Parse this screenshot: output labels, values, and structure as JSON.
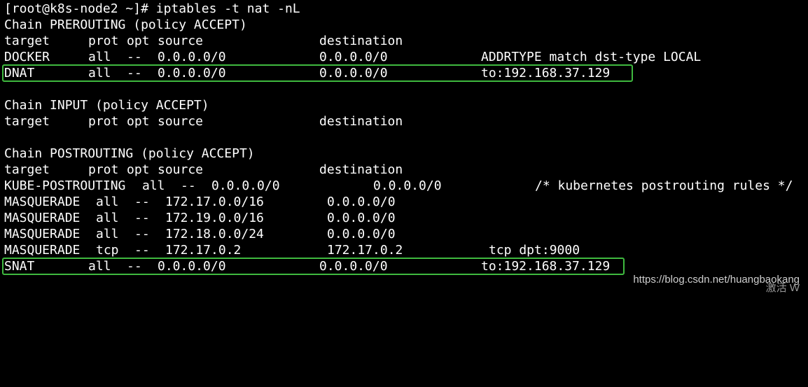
{
  "terminal": {
    "prompt_line": "[root@k8s-node2 ~]# iptables -t nat -nL",
    "prerouting": {
      "chain_header": "Chain PREROUTING (policy ACCEPT)",
      "columns": {
        "target": "target",
        "prot": "prot",
        "opt": "opt",
        "source": "source",
        "destination": "destination"
      },
      "rows": [
        {
          "target": "DOCKER",
          "prot": "all",
          "opt": "--",
          "source": "0.0.0.0/0",
          "destination": "0.0.0.0/0",
          "extra": "ADDRTYPE match dst-type LOCAL"
        },
        {
          "target": "DNAT",
          "prot": "all",
          "opt": "--",
          "source": "0.0.0.0/0",
          "destination": "0.0.0.0/0",
          "extra": "to:192.168.37.129"
        }
      ]
    },
    "input": {
      "chain_header": "Chain INPUT (policy ACCEPT)",
      "columns": {
        "target": "target",
        "prot": "prot",
        "opt": "opt",
        "source": "source",
        "destination": "destination"
      }
    },
    "postrouting": {
      "chain_header": "Chain POSTROUTING (policy ACCEPT)",
      "columns": {
        "target": "target",
        "prot": "prot",
        "opt": "opt",
        "source": "source",
        "destination": "destination"
      },
      "rows": [
        {
          "target": "KUBE-POSTROUTING",
          "prot": "all",
          "opt": "--",
          "source": "0.0.0.0/0",
          "destination": "0.0.0.0/0",
          "extra": "/* kubernetes postrouting rules */"
        },
        {
          "target": "MASQUERADE",
          "prot": "all",
          "opt": "--",
          "source": "172.17.0.0/16",
          "destination": "0.0.0.0/0",
          "extra": ""
        },
        {
          "target": "MASQUERADE",
          "prot": "all",
          "opt": "--",
          "source": "172.19.0.0/16",
          "destination": "0.0.0.0/0",
          "extra": ""
        },
        {
          "target": "MASQUERADE",
          "prot": "all",
          "opt": "--",
          "source": "172.18.0.0/24",
          "destination": "0.0.0.0/0",
          "extra": ""
        },
        {
          "target": "MASQUERADE",
          "prot": "tcp",
          "opt": "--",
          "source": "172.17.0.2",
          "destination": "172.17.0.2",
          "extra": "tcp dpt:9000"
        },
        {
          "target": "SNAT",
          "prot": "all",
          "opt": "--",
          "source": "0.0.0.0/0",
          "destination": "0.0.0.0/0",
          "extra": "to:192.168.37.129"
        }
      ]
    }
  },
  "colors": {
    "background": "#000000",
    "text": "#ffffff",
    "highlight_border": "#3fb93f"
  },
  "watermark": {
    "url": "https://blog.csdn.net/huangbaokang",
    "activate": "激活 W"
  }
}
